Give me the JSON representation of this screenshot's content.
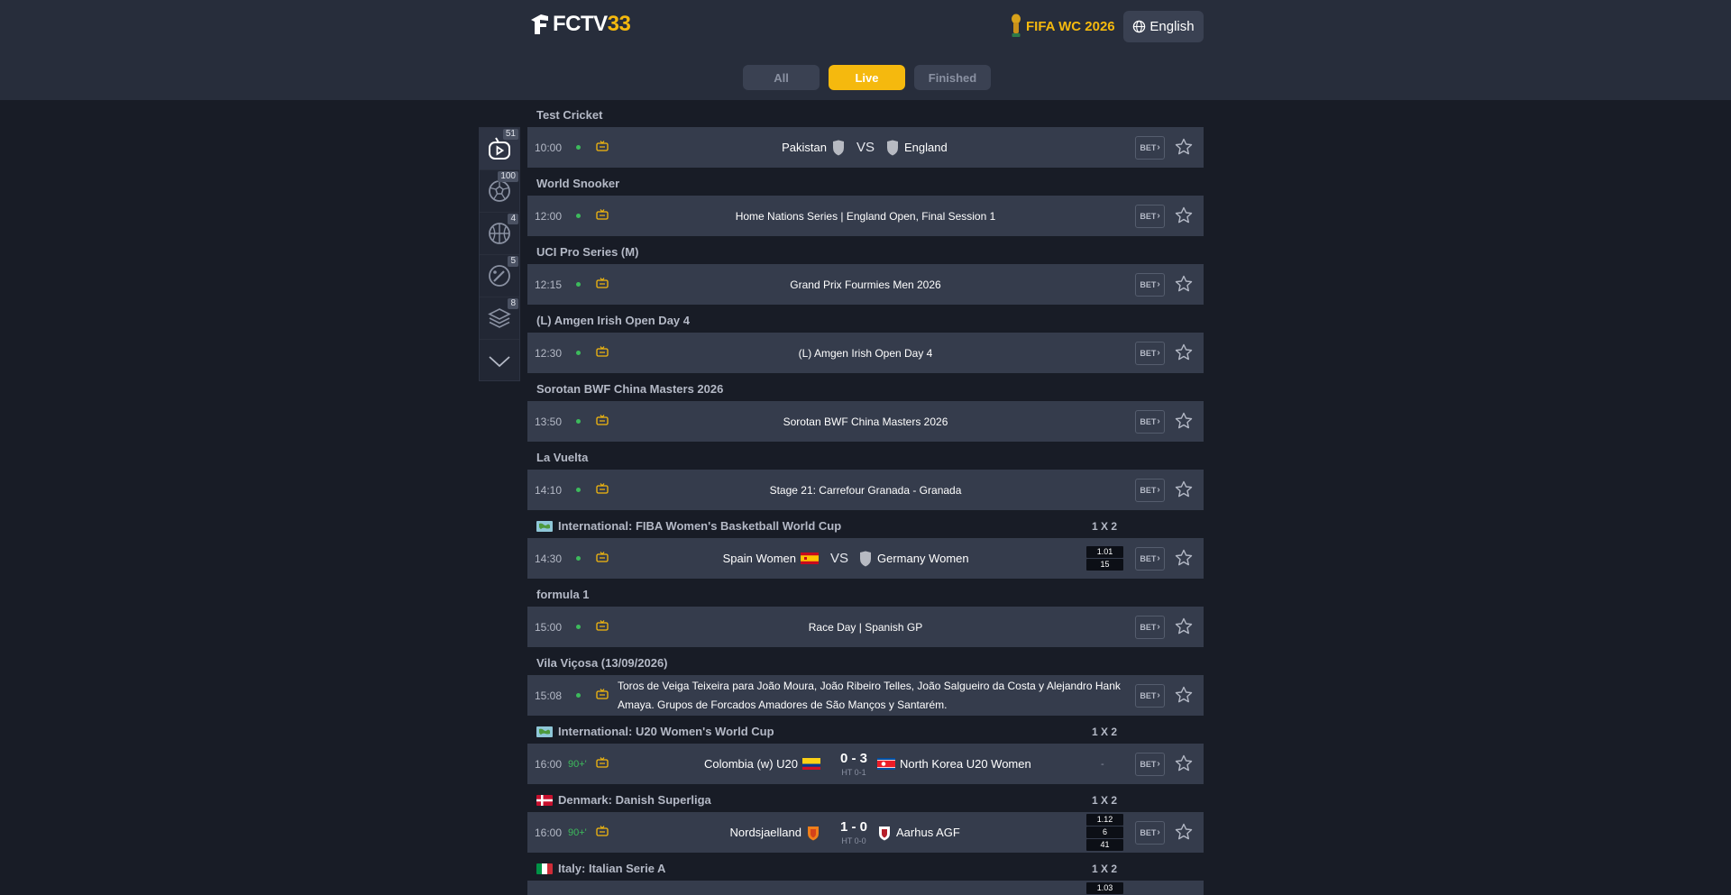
{
  "header": {
    "logo_text_a": "FCTV",
    "logo_text_b": "33",
    "world_cup_label": "FIFA WC 2026",
    "language_label": "English"
  },
  "tabs": [
    {
      "label": "All",
      "active": false
    },
    {
      "label": "Live",
      "active": true
    },
    {
      "label": "Finished",
      "active": false
    }
  ],
  "sidebar": [
    {
      "icon": "live-tv-icon",
      "count": "51"
    },
    {
      "icon": "soccer-ball-icon",
      "count": "100"
    },
    {
      "icon": "basketball-icon",
      "count": "4"
    },
    {
      "icon": "baseball-icon",
      "count": "5"
    },
    {
      "icon": "layers-icon",
      "count": "8"
    },
    {
      "icon": "chevron-down-icon",
      "count": ""
    }
  ],
  "colors": {
    "accent": "#f5b90e",
    "live_green": "#3dbb5c",
    "row_bg": "#353c4c",
    "page_bg": "#181c26"
  },
  "bet_label": "BET",
  "odds_header": "1 X 2",
  "groups": [
    {
      "league": "Test Cricket",
      "time": "10:00",
      "home": "Pakistan",
      "vs": "VS",
      "away": "England"
    },
    {
      "league": "World Snooker",
      "time": "12:00",
      "title": "Home Nations Series | England Open, Final Session 1"
    },
    {
      "league": "UCI Pro Series (M)",
      "time": "12:15",
      "title": "Grand Prix Fourmies Men 2026"
    },
    {
      "league": "(L) Amgen Irish Open Day 4",
      "time": "12:30",
      "title": "(L) Amgen Irish Open Day 4"
    },
    {
      "league": "Sorotan BWF China Masters 2026",
      "time": "13:50",
      "title": "Sorotan BWF China Masters 2026"
    },
    {
      "league": "La Vuelta",
      "time": "14:10",
      "title": "Stage 21: Carrefour Granada - Granada"
    },
    {
      "league": "International: FIBA Women's Basketball World Cup",
      "time": "14:30",
      "home": "Spain Women",
      "vs": "VS",
      "away": "Germany Women",
      "odds": [
        "1.01",
        "15"
      ]
    },
    {
      "league": "formula 1",
      "time": "15:00",
      "title": "Race Day | Spanish GP"
    },
    {
      "league": "Vila Viçosa (13/09/2026)",
      "time": "15:08",
      "title": "Toros de Veiga Teixeira para João Moura, João Ribeiro Telles, João Salgueiro da Costa y Alejandro Hank Amaya. Grupos de Forcados Amadores de São Manços y Santarém."
    },
    {
      "league": "International: U20 Women's World Cup",
      "time": "16:00",
      "minute": "90+",
      "home": "Colombia (w) U20",
      "score": "0 - 3",
      "ht": "HT 0-1",
      "away": "North Korea U20 Women",
      "odds_dash": "-"
    },
    {
      "league": "Denmark: Danish Superliga",
      "time": "16:00",
      "minute": "90+",
      "home": "Nordsjaelland",
      "score": "1 - 0",
      "ht": "HT 0-0",
      "away": "Aarhus AGF",
      "odds": [
        "1.12",
        "6",
        "41"
      ]
    },
    {
      "league": "Italy: Italian Serie A",
      "odds": [
        "1.03"
      ]
    }
  ]
}
